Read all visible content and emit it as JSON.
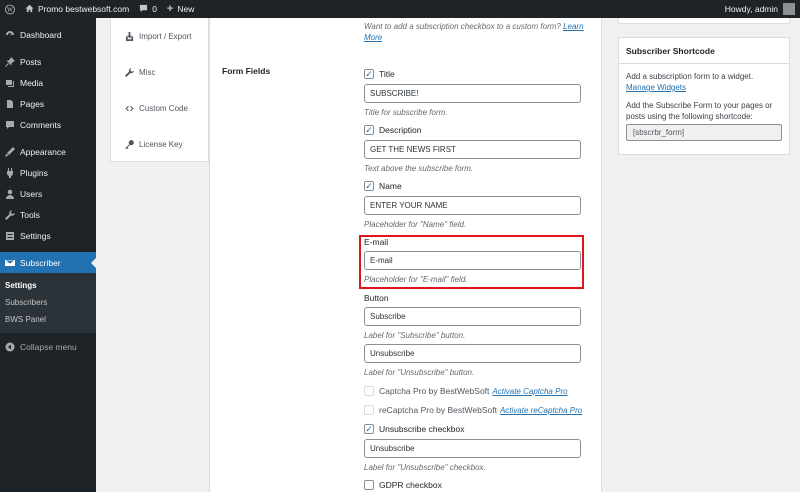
{
  "adminbar": {
    "site_name": "Promo bestwebsoft.com",
    "comments_count": "0",
    "new_label": "New",
    "greeting": "Howdy, admin"
  },
  "sidebar": {
    "items": [
      {
        "label": "Dashboard",
        "icon": "dashboard-icon"
      },
      {
        "label": "Posts",
        "icon": "pin-icon"
      },
      {
        "label": "Media",
        "icon": "media-icon"
      },
      {
        "label": "Pages",
        "icon": "pages-icon"
      },
      {
        "label": "Comments",
        "icon": "comments-icon"
      },
      {
        "label": "Appearance",
        "icon": "appearance-icon"
      },
      {
        "label": "Plugins",
        "icon": "plugins-icon"
      },
      {
        "label": "Users",
        "icon": "users-icon"
      },
      {
        "label": "Tools",
        "icon": "tools-icon"
      },
      {
        "label": "Settings",
        "icon": "settings-icon"
      },
      {
        "label": "Subscriber",
        "icon": "envelope-icon"
      }
    ],
    "submenu": [
      "Settings",
      "Subscribers",
      "BWS Panel"
    ],
    "collapse": "Collapse menu"
  },
  "tabs": [
    "Import / Export",
    "Misc",
    "Custom Code",
    "License Key"
  ],
  "form": {
    "top_desc": "Want to add a subscription checkbox to a custom form?",
    "learn_more": "Learn More",
    "section_label": "Form Fields",
    "title_cb": "Title",
    "title_value": "SUBSCRIBE!",
    "title_desc": "Title for subscribe form.",
    "desc_cb": "Description",
    "desc_value": "GET THE NEWS FIRST",
    "desc_desc": "Text above the subscribe form.",
    "name_cb": "Name",
    "name_value": "ENTER YOUR NAME",
    "name_desc": "Placeholder for \"Name\" field.",
    "email_label": "E-mail",
    "email_value": "E-mail",
    "email_desc": "Placeholder for \"E-mail\" field.",
    "button_label": "Button",
    "subscribe_value": "Subscribe",
    "subscribe_desc": "Label for \"Subscribe\" button.",
    "unsubscribe_value": "Unsubscribe",
    "unsubscribe_desc": "Label for \"Unsubscribe\" button.",
    "captcha_label": "Captcha Pro by BestWebSoft",
    "captcha_link": "Activate Captcha Pro",
    "recaptcha_label": "reCaptcha Pro by BestWebSoft",
    "recaptcha_link": "Activate reCaptcha Pro",
    "unsub_cb": "Unsubscribe checkbox",
    "unsub_cb_value": "Unsubscribe",
    "unsub_cb_desc": "Label for \"Unsubscribe\" checkbox.",
    "gdpr_cb": "GDPR checkbox"
  },
  "widget": {
    "title": "Subscriber Shortcode",
    "text1": "Add a subscription form to a widget.",
    "manage_link": "Manage Widgets",
    "text2": "Add the Subscribe Form to your pages or posts using the following shortcode:",
    "shortcode": "[sbscrbr_form]"
  },
  "colors": {
    "admin_dark": "#1d2327",
    "accent": "#2271b1",
    "highlight": "#e3131b"
  }
}
